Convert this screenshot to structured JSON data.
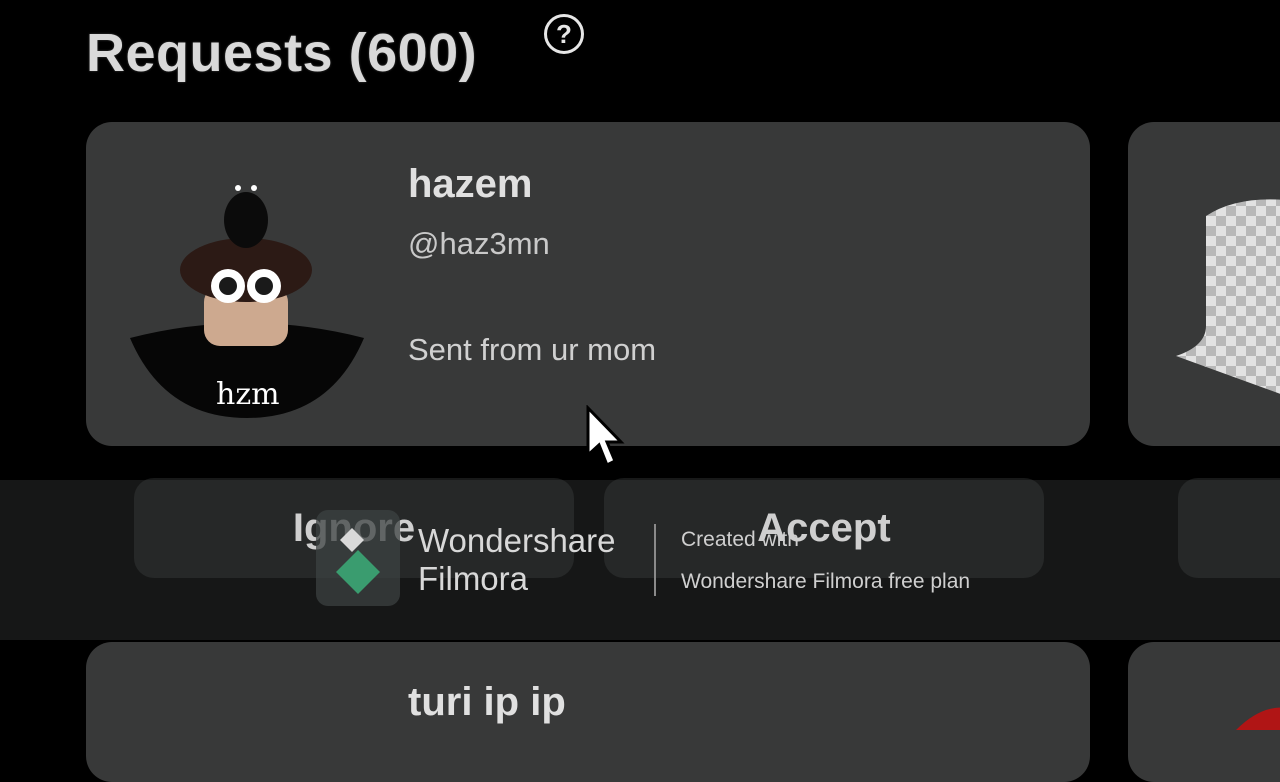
{
  "header": {
    "title": "Requests (600)",
    "help_glyph": "?"
  },
  "request": {
    "display_name": "hazem",
    "username": "@haz3mn",
    "source": "Sent from ur mom",
    "shirt_text": "hzm",
    "ignore_label": "Ignore",
    "accept_label": "Accept"
  },
  "next_request": {
    "display_name": "turi ip ip"
  },
  "watermark": {
    "brand_line1": "Wondershare",
    "brand_line2": "Filmora",
    "note_line1": "Created with",
    "note_line2": "Wondershare Filmora free plan"
  },
  "colors": {
    "background": "#000000",
    "card": "#383939",
    "text": "#e0e0e0",
    "watermark_green": "#3a9c6f"
  }
}
